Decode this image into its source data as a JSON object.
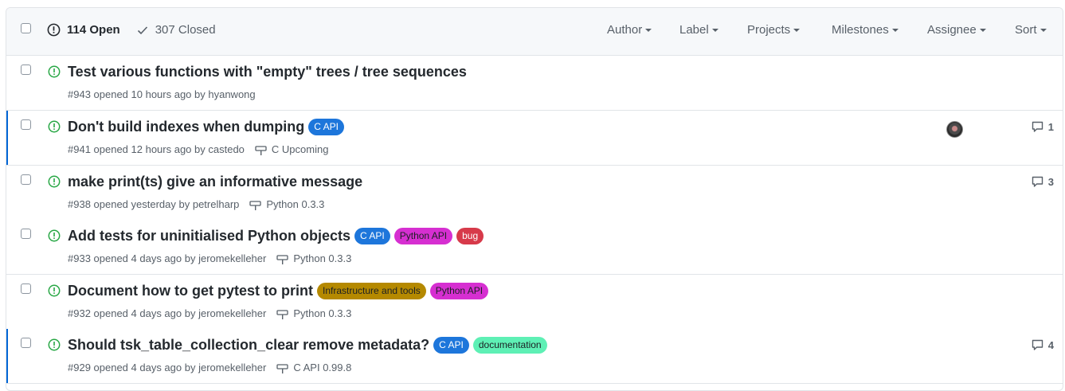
{
  "header": {
    "open_count": "114 Open",
    "closed_count": "307 Closed",
    "filters": [
      "Author",
      "Label",
      "Projects",
      "Milestones",
      "Assignee",
      "Sort"
    ]
  },
  "colors": {
    "open_icon": "#28a745",
    "unread_bar": "#0366d6",
    "c_api": "#1d76db",
    "python_api": "#d62fd1",
    "bug": "#d73a4a",
    "infrastructure": "#b58900",
    "documentation": "#5ef0b5"
  },
  "issues": [
    {
      "title": "Test various functions with \"empty\" trees / tree sequences",
      "meta": "#943 opened 10 hours ago by hyanwong",
      "labels": [],
      "milestone": "",
      "comments": ""
    },
    {
      "title": "Don't build indexes when dumping",
      "meta": "#941 opened 12 hours ago by castedo",
      "labels": [
        "C API"
      ],
      "milestone": "C Upcoming",
      "comments": "1"
    },
    {
      "title": "make print(ts) give an informative message",
      "meta": "#938 opened yesterday by petrelharp",
      "labels": [],
      "milestone": "Python 0.3.3",
      "comments": "3"
    },
    {
      "title": "Add tests for uninitialised Python objects",
      "meta": "#933 opened 4 days ago by jeromekelleher",
      "labels": [
        "C API",
        "Python API",
        "bug"
      ],
      "milestone": "Python 0.3.3",
      "comments": ""
    },
    {
      "title": "Document how to get pytest to print",
      "meta": "#932 opened 4 days ago by jeromekelleher",
      "labels": [
        "Infrastructure and tools",
        "Python API"
      ],
      "milestone": "Python 0.3.3",
      "comments": ""
    },
    {
      "title": "Should tsk_table_collection_clear remove metadata?",
      "meta": "#929 opened 4 days ago by jeromekelleher",
      "labels": [
        "C API",
        "documentation"
      ],
      "milestone": "C API 0.99.8",
      "comments": "4"
    }
  ]
}
